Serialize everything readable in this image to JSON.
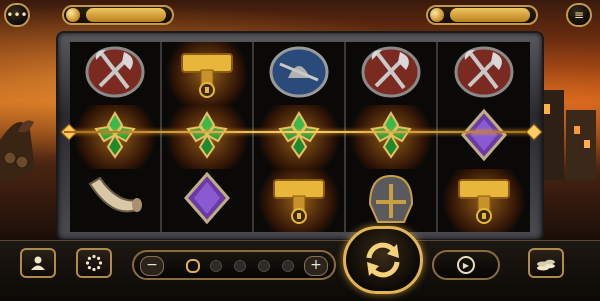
{
  "header": {
    "menu_icon": "ellipsis-icon",
    "settings_icon": "hamburger-icon",
    "balance": "",
    "bet_display": ""
  },
  "reels": {
    "grid": [
      [
        "axe-shield",
        "thor-hammer",
        "warrior-shield",
        "axe-shield",
        "axe-shield"
      ],
      [
        "green-clover-gem",
        "green-clover-gem",
        "green-clover-gem",
        "green-clover-gem",
        "purple-gem"
      ],
      [
        "drinking-horn",
        "purple-gem",
        "thor-hammer",
        "viking-helmet",
        "thor-hammer"
      ]
    ],
    "winning_row": 2
  },
  "controls": {
    "minus_label": "−",
    "plus_label": "+",
    "bet_level": 1,
    "bet_levels_total": 5,
    "profile_icon": "user-icon",
    "settings_icon": "dots-circle-icon",
    "spin_icon": "refresh-icon",
    "autoplay_icon": "play-icon",
    "coins_icon": "coin-stack-icon"
  },
  "colors": {
    "gold": "#e2b452",
    "win_glow": "#ffb030"
  }
}
